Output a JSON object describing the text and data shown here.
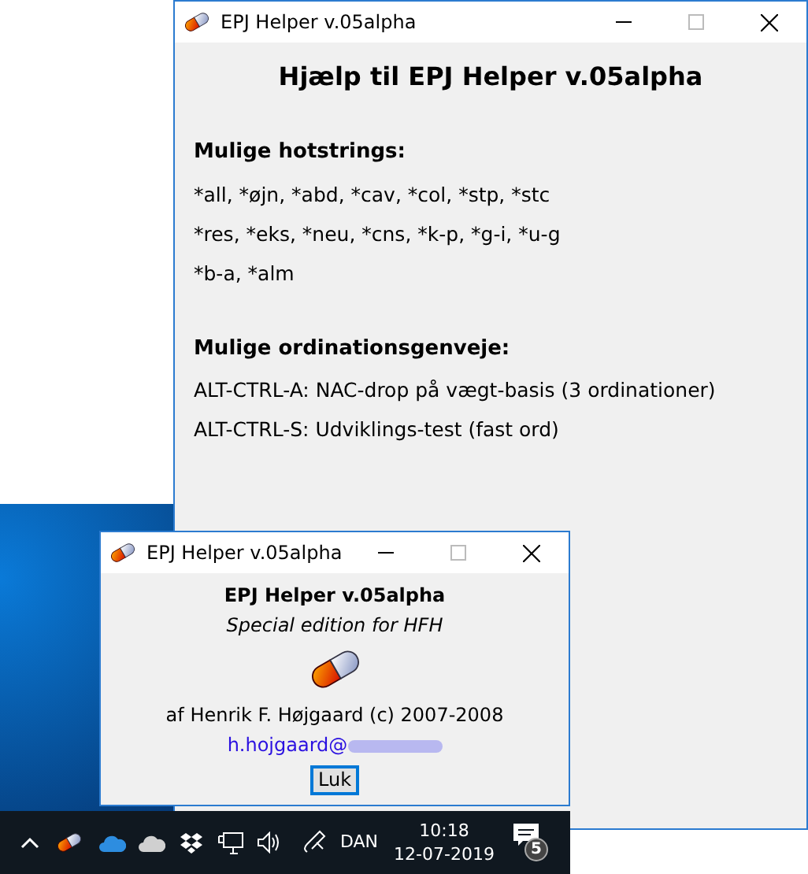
{
  "main_window": {
    "title": "EPJ Helper v.05alpha",
    "heading": "Hjælp til EPJ Helper v.05alpha",
    "sections": [
      {
        "title": "Mulige hotstrings:",
        "lines": [
          "*all, *øjn, *abd, *cav, *col, *stp, *stc",
          "*res, *eks, *neu, *cns, *k-p, *g-i, *u-g",
          "*b-a, *alm"
        ]
      },
      {
        "title": "Mulige ordinationsgenveje:",
        "lines": [
          "ALT-CTRL-A: NAC-drop på vægt-basis (3 ordinationer)",
          "ALT-CTRL-S: Udviklings-test (fast ord)"
        ]
      }
    ]
  },
  "about_window": {
    "title": "EPJ Helper v.05alpha",
    "name": "EPJ Helper v.05alpha",
    "subtitle": "Special edition for HFH",
    "author": "af Henrik F. Højgaard (c) 2007-2008",
    "email": "h.hojgaard@",
    "button": "Luk"
  },
  "taskbar": {
    "language": "DAN",
    "time": "10:18",
    "date": "12-07-2019",
    "notifications": "5"
  }
}
